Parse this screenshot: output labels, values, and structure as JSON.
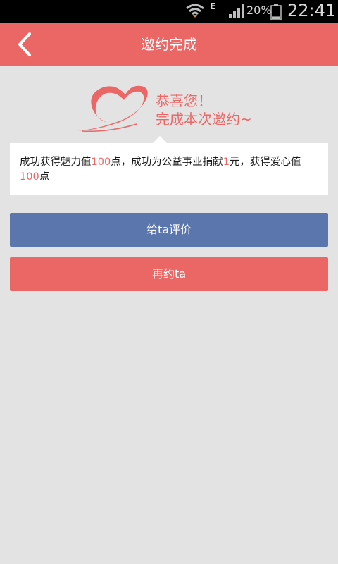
{
  "status_bar": {
    "net_type": "E",
    "battery_percent": "20%",
    "battery_level": 0.2,
    "time": "22:41"
  },
  "header": {
    "title": "邀约完成"
  },
  "congrats": {
    "line1": "恭喜您！",
    "line2": "完成本次邀约~"
  },
  "message": {
    "part1": "成功获得魅力值",
    "charm_points": "100",
    "part2": "点，成功为公益事业捐献",
    "donation": "1",
    "part3": "元，获得爱心值",
    "love_points": "100",
    "part4": "点"
  },
  "buttons": {
    "rate_label": "给ta评价",
    "reinvite_label": "再约ta"
  },
  "colors": {
    "accent": "#ea6766",
    "rate_button": "#5a76ad",
    "background": "#e3e3e3"
  },
  "icons": {
    "back": "chevron-left-icon",
    "logo": "heart-icon"
  }
}
